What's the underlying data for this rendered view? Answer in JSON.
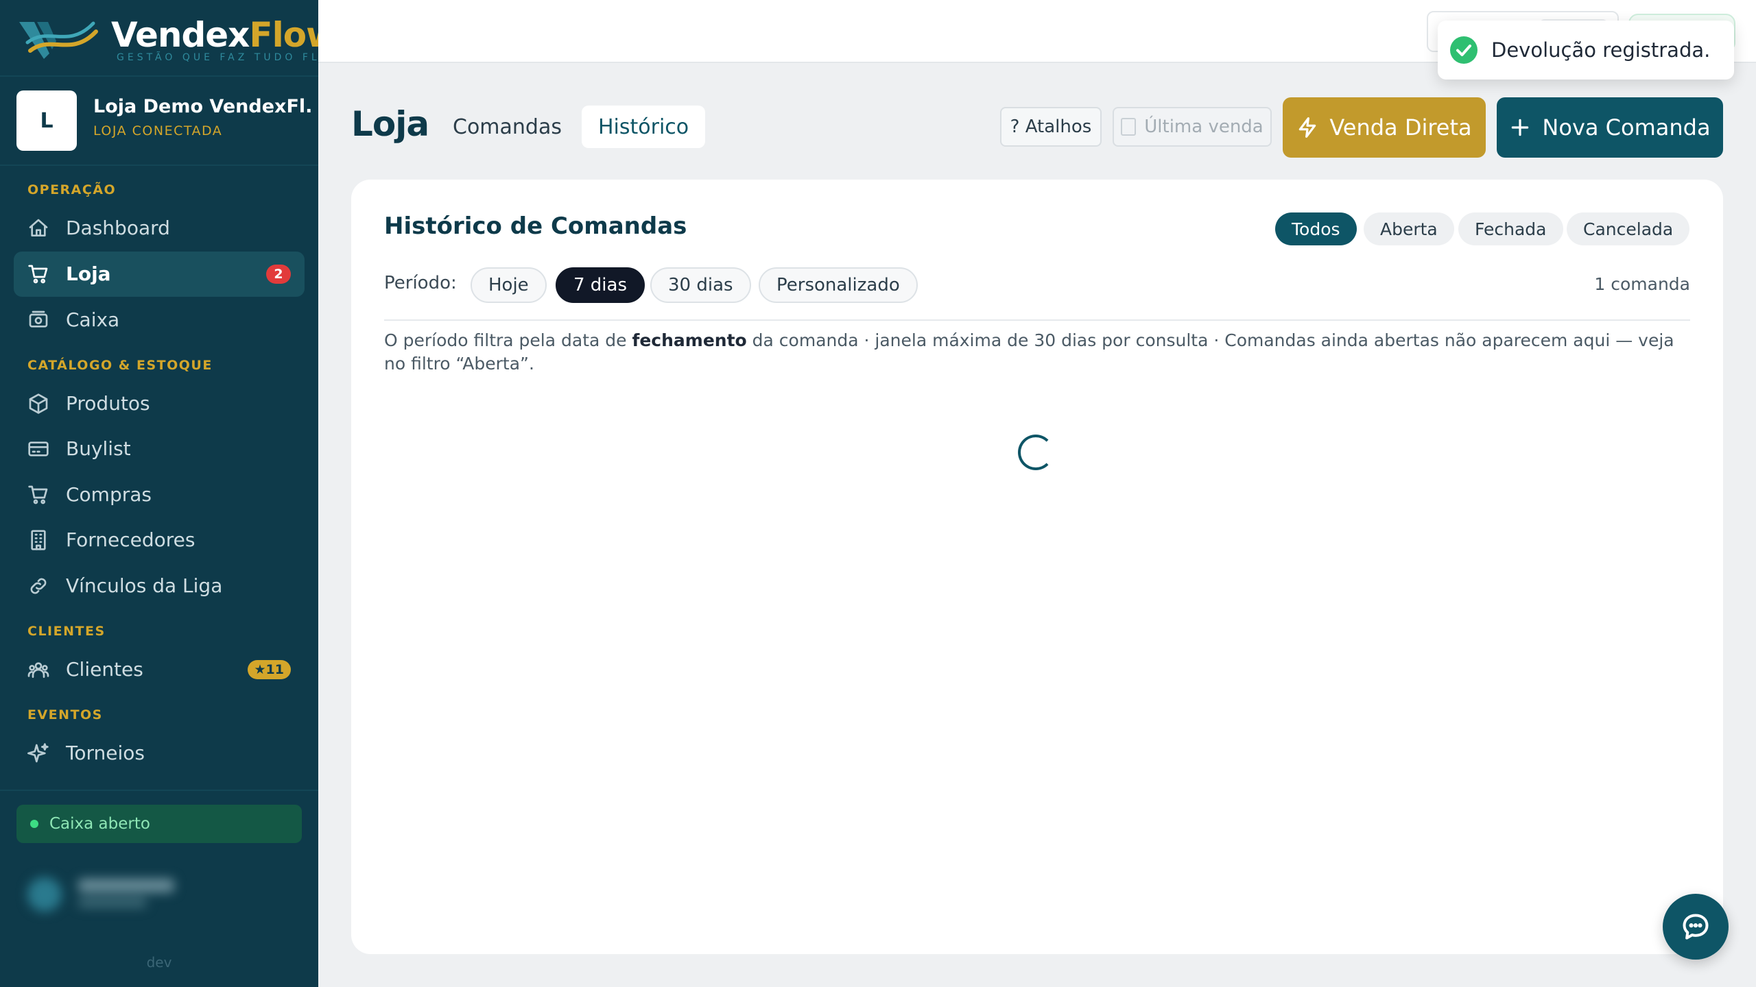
{
  "brand": {
    "name_part1": "Vendex",
    "name_part2": "Flow",
    "tagline": "GESTÃO QUE FAZ TUDO FLUIR"
  },
  "store": {
    "initial": "L",
    "name": "Loja Demo VendexFl...",
    "status": "LOJA CONECTADA"
  },
  "sidebar": {
    "sections": {
      "operacao": "OPERAÇÃO",
      "catalogo": "CATÁLOGO & ESTOQUE",
      "clientes": "CLIENTES",
      "eventos": "EVENTOS"
    },
    "items": {
      "dashboard": "Dashboard",
      "loja": "Loja",
      "loja_badge": "2",
      "caixa": "Caixa",
      "produtos": "Produtos",
      "buylist": "Buylist",
      "compras": "Compras",
      "fornecedores": "Fornecedores",
      "vinculos": "Vínculos da Liga",
      "clientes": "Clientes",
      "clientes_badge": "★11",
      "torneios": "Torneios"
    },
    "caixa_status": "Caixa aberto",
    "env": "dev"
  },
  "toast": {
    "message": "Devolução registrada."
  },
  "header": {
    "title": "Loja",
    "tabs": {
      "comandas": "Comandas",
      "historico": "Histórico"
    },
    "atalhos": "? Atalhos",
    "ultima_venda": "Última venda",
    "venda_direta": "Venda Direta",
    "nova_comanda": "Nova Comanda"
  },
  "card": {
    "title": "Histórico de Comandas",
    "status_filters": {
      "todos": "Todos",
      "aberta": "Aberta",
      "fechada": "Fechada",
      "cancelada": "Cancelada"
    },
    "periodo_label": "Período:",
    "periods": {
      "hoje": "Hoje",
      "sete_dias": "7 dias",
      "trinta_dias": "30 dias",
      "personalizado": "Personalizado"
    },
    "count": "1 comanda",
    "info_part1": "O período filtra pela data de ",
    "info_bold": "fechamento",
    "info_part2": " da comanda · janela máxima de 30 dias por consulta · Comandas ainda abertas não aparecem aqui — veja no filtro “Aberta”."
  },
  "colors": {
    "sidebar_bg": "#0e3a4a",
    "accent_gold": "#d4a62a",
    "primary_teal": "#0e5566",
    "danger_red": "#e23b3b",
    "success_green": "#3ddc84"
  },
  "icons": {
    "dashboard": "home-icon",
    "loja": "cart-icon",
    "caixa": "cash-register-icon",
    "produtos": "box-icon",
    "buylist": "card-icon",
    "compras": "cart-icon",
    "fornecedores": "building-icon",
    "vinculos": "link-icon",
    "clientes": "users-icon",
    "torneios": "sparkles-icon",
    "toast": "check-circle-icon",
    "venda_direta": "lightning-icon",
    "nova_comanda": "plus-icon",
    "chat": "chat-icon"
  }
}
